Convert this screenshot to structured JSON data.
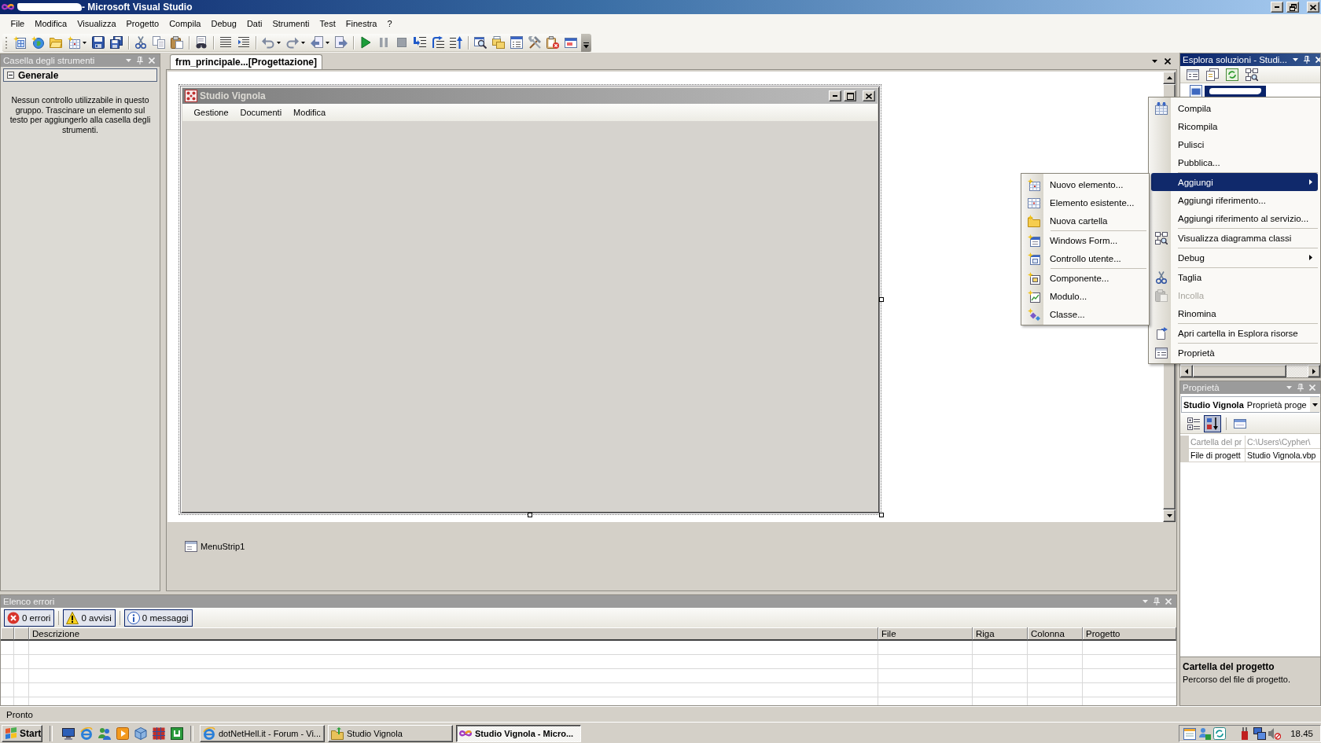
{
  "window": {
    "title": "- Microsoft Visual Studio"
  },
  "menu_bar": [
    "File",
    "Modifica",
    "Visualizza",
    "Progetto",
    "Compila",
    "Debug",
    "Dati",
    "Strumenti",
    "Test",
    "Finestra",
    "?"
  ],
  "toolbox": {
    "title": "Casella degli strumenti",
    "active": false,
    "groups": [
      {
        "label": "Generale",
        "expanded": true,
        "empty_message": "Nessun controllo utilizzabile in questo gruppo. Trascinare un elemento sul testo per aggiungerlo alla casella degli strumenti."
      }
    ]
  },
  "document_tabs": [
    {
      "label": "frm_principale...[Progettazione]",
      "selected": true
    }
  ],
  "designer": {
    "form": {
      "title": "Studio Vignola",
      "menu": [
        "Gestione",
        "Documenti",
        "Modifica"
      ]
    },
    "components": [
      "MenuStrip1"
    ]
  },
  "solution_explorer": {
    "title": "Esplora soluzioni - Studi...",
    "active": true,
    "tree": [
      {
        "selected": true
      }
    ]
  },
  "context_menu": {
    "groups": [
      {
        "items": [
          {
            "label": "Compila",
            "selected": false,
            "disabled": false,
            "has_submenu": false
          },
          {
            "label": "Ricompila",
            "selected": false,
            "disabled": false,
            "has_submenu": false
          },
          {
            "label": "Pulisci",
            "selected": false,
            "disabled": false,
            "has_submenu": false
          },
          {
            "label": "Pubblica...",
            "selected": false,
            "disabled": false,
            "has_submenu": false
          }
        ]
      },
      {
        "items": [
          {
            "label": "Aggiungi",
            "selected": true,
            "disabled": false,
            "has_submenu": true
          },
          {
            "label": "Aggiungi riferimento...",
            "selected": false,
            "disabled": false,
            "has_submenu": false
          },
          {
            "label": "Aggiungi riferimento al servizio...",
            "selected": false,
            "disabled": false,
            "has_submenu": false
          }
        ]
      },
      {
        "items": [
          {
            "label": "Visualizza diagramma classi",
            "selected": false,
            "disabled": false,
            "has_submenu": false
          }
        ]
      },
      {
        "items": [
          {
            "label": "Debug",
            "selected": false,
            "disabled": false,
            "has_submenu": true
          }
        ]
      },
      {
        "items": [
          {
            "label": "Taglia",
            "selected": false,
            "disabled": false,
            "has_submenu": false
          },
          {
            "label": "Incolla",
            "selected": false,
            "disabled": true,
            "has_submenu": false
          },
          {
            "label": "Rinomina",
            "selected": false,
            "disabled": false,
            "has_submenu": false
          }
        ]
      },
      {
        "items": [
          {
            "label": "Apri cartella in Esplora risorse",
            "selected": false,
            "disabled": false,
            "has_submenu": false
          }
        ]
      },
      {
        "items": [
          {
            "label": "Proprietà",
            "selected": false,
            "disabled": false,
            "has_submenu": false
          }
        ]
      }
    ]
  },
  "submenu": {
    "groups": [
      {
        "items": [
          {
            "label": "Nuovo elemento...",
            "selected": false
          },
          {
            "label": "Elemento esistente...",
            "selected": false
          },
          {
            "label": "Nuova cartella",
            "selected": false
          }
        ]
      },
      {
        "items": [
          {
            "label": "Windows Form...",
            "selected": false
          },
          {
            "label": "Controllo utente...",
            "selected": false
          }
        ]
      },
      {
        "items": [
          {
            "label": "Componente...",
            "selected": false
          },
          {
            "label": "Modulo...",
            "selected": false
          },
          {
            "label": "Classe...",
            "selected": false
          }
        ]
      }
    ]
  },
  "properties": {
    "title": "Proprietà",
    "active": false,
    "object_name": "Studio Vignola",
    "object_type": "Proprietà proge",
    "sort_buttons": [
      {
        "selected": false
      },
      {
        "selected": true
      }
    ],
    "rows": [
      {
        "name": "Cartella del pr",
        "value": "C:\\Users\\Cypher\\",
        "disabled": true
      },
      {
        "name": "File di progett",
        "value": "Studio Vignola.vbp",
        "disabled": false
      }
    ],
    "description": {
      "title": "Cartella del progetto",
      "text": "Percorso del file di progetto."
    }
  },
  "error_list": {
    "title": "Elenco errori",
    "active": false,
    "filters": [
      {
        "label": "0 errori",
        "kind": "error",
        "on": true
      },
      {
        "label": "0 avvisi",
        "kind": "warning",
        "on": true
      },
      {
        "label": "0 messaggi",
        "kind": "info",
        "on": true
      }
    ],
    "columns": [
      "Descrizione",
      "File",
      "Riga",
      "Colonna",
      "Progetto"
    ]
  },
  "status_bar": {
    "text": "Pronto"
  },
  "taskbar": {
    "start": "Start",
    "tasks": [
      {
        "label": "dotNetHell.it - Forum - Vi...",
        "selected": false
      },
      {
        "label": "Studio Vignola",
        "selected": false
      },
      {
        "label": "Studio Vignola - Micro...",
        "selected": true
      }
    ],
    "clock": "18.45"
  }
}
